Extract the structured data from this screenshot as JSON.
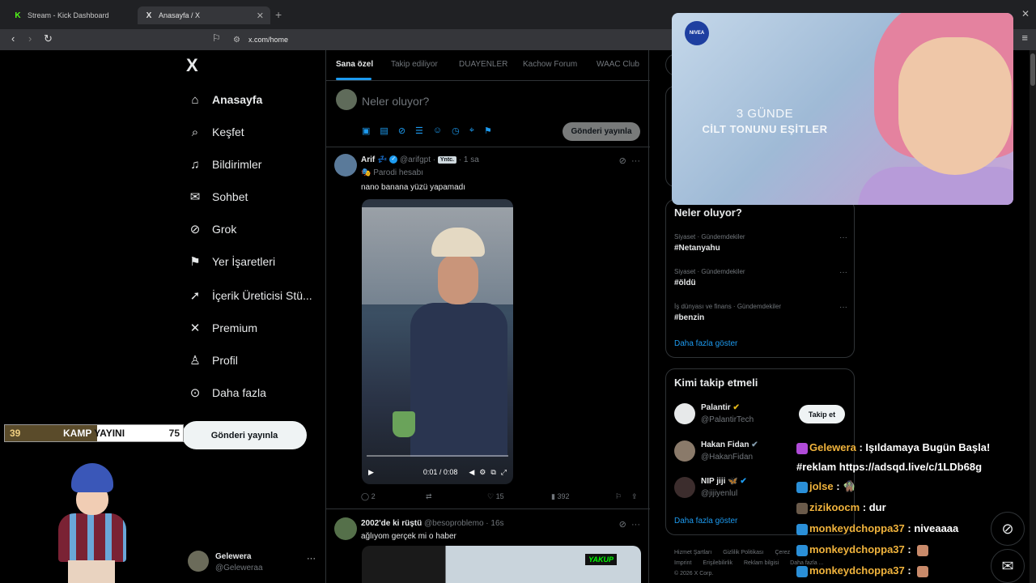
{
  "browser": {
    "tabs": [
      {
        "title": "Stream - Kick Dashboard",
        "favicon": "K"
      },
      {
        "title": "Anasayfa / X",
        "favicon": "X"
      }
    ],
    "new_tab": "+",
    "url": "x.com/home"
  },
  "nav": {
    "logo": "X",
    "items": [
      {
        "label": "Anasayfa",
        "icon": "home-icon",
        "glyph": "⌂"
      },
      {
        "label": "Keşfet",
        "icon": "search-icon",
        "glyph": "⌕"
      },
      {
        "label": "Bildirimler",
        "icon": "bell-icon",
        "glyph": "♫"
      },
      {
        "label": "Sohbet",
        "icon": "mail-icon",
        "glyph": "✉"
      },
      {
        "label": "Grok",
        "icon": "grok-icon",
        "glyph": "⊘"
      },
      {
        "label": "Yer İşaretleri",
        "icon": "bookmark-icon",
        "glyph": "⚑"
      },
      {
        "label": "İçerik Üreticisi Stü...",
        "icon": "rocket-icon",
        "glyph": "➚"
      },
      {
        "label": "Premium",
        "icon": "x-icon",
        "glyph": "✕"
      },
      {
        "label": "Profil",
        "icon": "person-icon",
        "glyph": "♙"
      },
      {
        "label": "Daha fazla",
        "icon": "more-circle-icon",
        "glyph": "⊙"
      }
    ],
    "post_button": "Gönderi yayınla",
    "account": {
      "name": "Gelewera",
      "handle": "@Geleweraa",
      "more": "···"
    }
  },
  "feed": {
    "tabs": [
      "Sana özel",
      "Takip ediliyor",
      "DUAYENLER",
      "Kachow Forum",
      "WAAC Club"
    ],
    "composer": {
      "placeholder": "Neler oluyor?",
      "button": "Gönderi yayınla"
    },
    "tweets": [
      {
        "name": "Arif",
        "name_suffix": "💤",
        "handle": "@arifgpt",
        "badge": "Yntc.",
        "time": "· 1 sa",
        "parody": "Parodi hesabı",
        "text": "nano banana yüzü yapamadı",
        "video_time": "0:01 / 0:08",
        "replies": "2",
        "likes": "15",
        "views": "392"
      },
      {
        "name": "2002'de ki rüştü",
        "handle": "@besoproblemo",
        "time": "· 16s",
        "text": "ağlıyom gerçek mi o haber",
        "media_text": "YAKUP"
      }
    ]
  },
  "sidebar": {
    "trends_title": "Neler oluyor?",
    "trends": [
      {
        "category": "Siyaset · Gündemdekiler",
        "tag": "#Netanyahu"
      },
      {
        "category": "Siyaset · Gündemdekiler",
        "tag": "#öldü"
      },
      {
        "category": "İş dünyası ve finans · Gündemdekiler",
        "tag": "#benzin"
      }
    ],
    "trends_more": "Daha fazla göster",
    "wtf_title": "Kimi takip etmeli",
    "suggestions": [
      {
        "name": "Palantir",
        "handle": "@PalantirTech"
      },
      {
        "name": "Hakan Fidan",
        "handle": "@HakanFidan"
      },
      {
        "name": "NIP jiji 🦋",
        "handle": "@jijiyenlul"
      }
    ],
    "follow_button": "Takip et",
    "wtf_more": "Daha fazla göster",
    "footer": [
      "Hizmet Şartları",
      "Gizlilik Politikası",
      "Çerez",
      "Imprint",
      "Erişilebilirlik",
      "Reklam bilgisi",
      "Daha fazla ...",
      "© 2026 X Corp."
    ]
  },
  "ad_overlay": {
    "brand": "NIVEA",
    "line1": "3 GÜNDE",
    "line2": "CİLT TONUNU EŞİTLER"
  },
  "stream_overlay": {
    "score_left": "39",
    "score_right": "75",
    "score_text": "KAMP YAYINI",
    "score_fill_fraction": 0.52
  },
  "chat": [
    {
      "user": "Gelewera",
      "sep": " : ",
      "text": "Işıldamaya Bugün Başla!"
    },
    {
      "user": "",
      "sep": "",
      "text": "#reklam https://adsqd.live/c/1LDb68g"
    },
    {
      "user": "jolse",
      "sep": " : ",
      "text": "🧌"
    },
    {
      "user": "zizikoocm",
      "sep": " : ",
      "text": "dur"
    },
    {
      "user": "monkeydchoppa37",
      "sep": " : ",
      "text": "niveaaaa"
    },
    {
      "user": "monkeydchoppa37",
      "sep": " : ",
      "text": ""
    },
    {
      "user": "monkeydchoppa37",
      "sep": " : ",
      "text": ""
    }
  ],
  "colors": {
    "accent": "#1d9bf0",
    "chat_user": "#f0b33c",
    "kick_green": "#53fc18"
  }
}
